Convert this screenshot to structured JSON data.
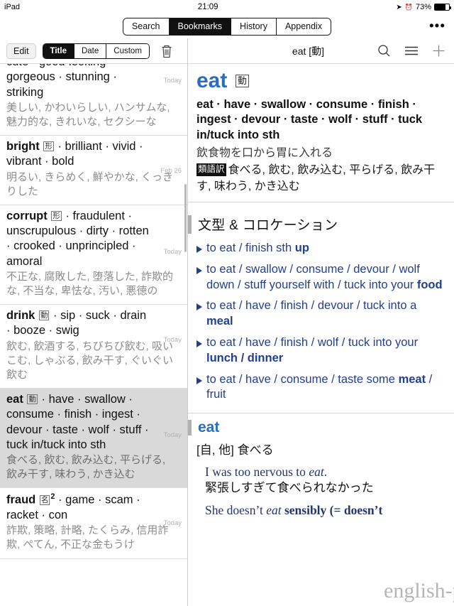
{
  "status_bar": {
    "device": "iPad",
    "time": "21:09",
    "battery_percent": "73%",
    "location_icon": "location-arrow-icon",
    "alarm_icon": "alarm-clock-icon",
    "battery_icon": "battery-icon"
  },
  "top_tabs": {
    "items": [
      {
        "label": "Search",
        "active": false
      },
      {
        "label": "Bookmarks",
        "active": true
      },
      {
        "label": "History",
        "active": false
      },
      {
        "label": "Appendix",
        "active": false
      }
    ],
    "more_label": "•••"
  },
  "left_toolbar": {
    "edit_label": "Edit",
    "sort_options": [
      {
        "label": "Title",
        "active": true
      },
      {
        "label": "Date",
        "active": false
      },
      {
        "label": "Custom",
        "active": false
      }
    ],
    "trash_icon": "trash-icon"
  },
  "bookmarks": [
    {
      "headword": "",
      "pos": "",
      "synonyms": "cute · good-looking · gorgeous · stunning · striking",
      "japanese": "美しい, かわいらしい, ハンサムな, 魅力的な, きれいな, セクシーな",
      "date": "Today",
      "selected": false,
      "clipped_top": true
    },
    {
      "headword": "bright",
      "pos": "形",
      "synonyms": "· brilliant · vivid · vibrant · bold",
      "japanese": "明るい, きらめく, 鮮やかな, くっきりした",
      "date": "Feb 26",
      "selected": false
    },
    {
      "headword": "corrupt",
      "pos": "形",
      "synonyms": "· fraudulent · unscrupulous · dirty · rotten · crooked · unprincipled · amoral",
      "japanese": "不正な, 腐敗した, 堕落した, 詐欺的な, 不当な, 卑怯な, 汚い, 悪徳の",
      "date": "Today",
      "selected": false
    },
    {
      "headword": "drink",
      "pos": "動",
      "synonyms": "· sip · suck · drain · booze · swig",
      "japanese": "飲む, 飲酒する, ちびちび飲む, 吸いこむ, しゃぶる, 飲み干す, ぐいぐい飲む",
      "date": "Today",
      "selected": false
    },
    {
      "headword": "eat",
      "pos": "動",
      "synonyms": "· have · swallow · consume · finish · ingest · devour · taste · wolf · stuff · tuck in/tuck into sth",
      "japanese": "食べる, 飲む, 飲み込む, 平らげる, 飲み干す, 味わう, かき込む",
      "date": "Today",
      "selected": true
    },
    {
      "headword": "fraud",
      "pos": "名",
      "pos_sup": "2",
      "synonyms": "· game · scam · racket · con",
      "japanese": "詐欺, 策略, 計略, たくらみ, 信用詐欺, ぺてん, 不正な金もうけ",
      "date": "Today",
      "selected": false
    }
  ],
  "right_toolbar": {
    "title": "eat [動]",
    "search_icon": "search-icon",
    "menu_icon": "hamburger-menu-icon",
    "add_icon": "plus-icon"
  },
  "entry": {
    "headword": "eat",
    "pos_box": "動",
    "synonym_line": "eat · have · swallow · consume · finish · ingest · devour · taste · wolf · stuff · tuck in/tuck into sth",
    "japanese_definition": "飲食物を口から胃に入れる",
    "translation_tag": "類語訳",
    "japanese_translation": "食べる, 飲む, 飲み込む, 平らげる, 飲み干す, 味わう, かき込む"
  },
  "collocation_section": {
    "title": "文型 & コロケーション",
    "items": [
      {
        "prefix": "to eat / finish sth ",
        "bold": "up",
        "suffix": ""
      },
      {
        "prefix": "to eat / swallow / consume / devour / wolf down / stuff yourself with / tuck into your ",
        "bold": "food",
        "suffix": ""
      },
      {
        "prefix": "to eat / have / finish / devour / tuck into a ",
        "bold": "meal",
        "suffix": ""
      },
      {
        "prefix": "to eat / have / finish / wolf / tuck into your ",
        "bold": "lunch / dinner",
        "suffix": ""
      },
      {
        "prefix": "to eat / have / consume / taste some ",
        "bold": "meat",
        "suffix": " / fruit"
      }
    ]
  },
  "sense_section": {
    "word": "eat",
    "grammar": "[自, 他] 食べる",
    "examples": [
      {
        "en_pre": "I was too nervous to ",
        "en_italic": "eat",
        "en_post": ".",
        "jp": "緊張しすぎて食べられなかった"
      },
      {
        "en_pre": "She doesn’t ",
        "en_italic": "eat",
        "en_post": " sensibly (= doesn’t",
        "jp": ""
      }
    ]
  },
  "watermark": "english-pal.net"
}
